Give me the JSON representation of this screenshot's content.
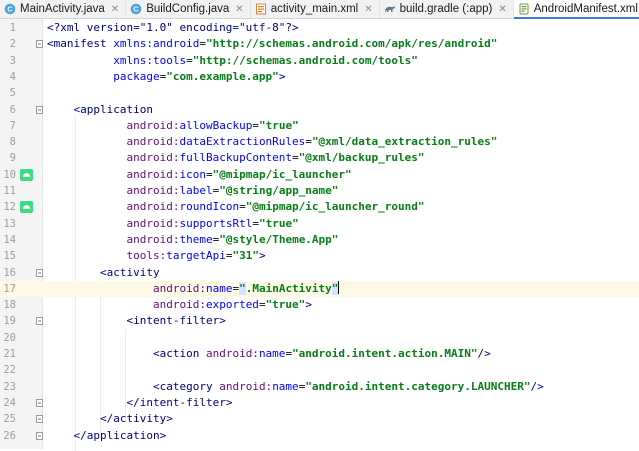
{
  "tabs": [
    {
      "label": "MainActivity.java",
      "icon": "java-class-icon",
      "active": false
    },
    {
      "label": "BuildConfig.java",
      "icon": "java-class-icon",
      "active": false
    },
    {
      "label": "activity_main.xml",
      "icon": "layout-xml-icon",
      "active": false
    },
    {
      "label": "build.gradle (:app)",
      "icon": "gradle-icon",
      "active": false
    },
    {
      "label": "AndroidManifest.xml",
      "icon": "manifest-icon",
      "active": true
    }
  ],
  "editor": {
    "current_line": 17,
    "lines": [
      {
        "n": "1"
      },
      {
        "n": "2"
      },
      {
        "n": "3"
      },
      {
        "n": "4"
      },
      {
        "n": "5"
      },
      {
        "n": "6"
      },
      {
        "n": "7"
      },
      {
        "n": "8"
      },
      {
        "n": "9"
      },
      {
        "n": "10"
      },
      {
        "n": "11"
      },
      {
        "n": "12"
      },
      {
        "n": "13"
      },
      {
        "n": "14"
      },
      {
        "n": "15"
      },
      {
        "n": "16"
      },
      {
        "n": "17"
      },
      {
        "n": "18"
      },
      {
        "n": "19"
      },
      {
        "n": "20"
      },
      {
        "n": "21"
      },
      {
        "n": "22"
      },
      {
        "n": "23"
      },
      {
        "n": "24"
      },
      {
        "n": "25"
      },
      {
        "n": "26"
      }
    ],
    "code": {
      "l1_prolog": "<?xml version=\"1.0\" encoding=\"utf-8\"?>",
      "l2_open": "<manifest",
      "l2_attr": "xmlns:android",
      "l2_val": "\"http://schemas.android.com/apk/res/android\"",
      "l3_attr": "xmlns:tools",
      "l3_val": "\"http://schemas.android.com/tools\"",
      "l4_attr": "package",
      "l4_val": "\"com.example.app\"",
      "l4_close": ">",
      "l7_open": "<application",
      "l8_ns": "android:",
      "l8_attr": "allowBackup",
      "l8_val": "\"true\"",
      "l9_ns": "android:",
      "l9_attr": "dataExtractionRules",
      "l9_val": "\"@xml/data_extraction_rules\"",
      "l10_ns": "android:",
      "l10_attr": "fullBackupContent",
      "l10_val": "\"@xml/backup_rules\"",
      "l11_ns": "android:",
      "l11_attr": "icon",
      "l11_val": "\"@mipmap/ic_launcher\"",
      "l12_ns": "android:",
      "l12_attr": "label",
      "l12_val": "\"@string/app_name\"",
      "l13_ns": "android:",
      "l13_attr": "roundIcon",
      "l13_val": "\"@mipmap/ic_launcher_round\"",
      "l14_ns": "android:",
      "l14_attr": "supportsRtl",
      "l14_val": "\"true\"",
      "l15_ns": "android:",
      "l15_attr": "theme",
      "l15_val": "\"@style/Theme.App\"",
      "l16_ns": "tools:",
      "l16_attr": "targetApi",
      "l16_val": "\"31\"",
      "l16_close": ">",
      "l17_open": "<activity",
      "l18_ns": "android:",
      "l18_attr": "name",
      "l18_q1": "\"",
      "l18_val": ".MainActivity",
      "l18_q2": "\"",
      "l19_ns": "android:",
      "l19_attr": "exported",
      "l19_val": "\"true\"",
      "l19_close": ">",
      "l20_tag": "<intent-filter>",
      "l22_open": "<action",
      "l22_ns": "android:",
      "l22_attr": "name",
      "l22_val": "\"android.intent.action.MAIN\"",
      "l22_close": "/>",
      "l24_open": "<category",
      "l24_ns": "android:",
      "l24_attr": "name",
      "l24_val": "\"android.intent.category.LAUNCHER\"",
      "l24_close": "/>",
      "l25_tag": "</intent-filter>",
      "l26_tag": "</activity>",
      "l27_tag": "</application>"
    },
    "gutter_icons": {
      "10": "launcher-icon",
      "12": "launcher-icon"
    }
  },
  "colors": {
    "tag": "#00007f",
    "attribute": "#0000ff",
    "namespace": "#660e7a",
    "value": "#067d17",
    "current_line": "#fcfae6",
    "active_tab_underline": "#3d7bd6"
  }
}
